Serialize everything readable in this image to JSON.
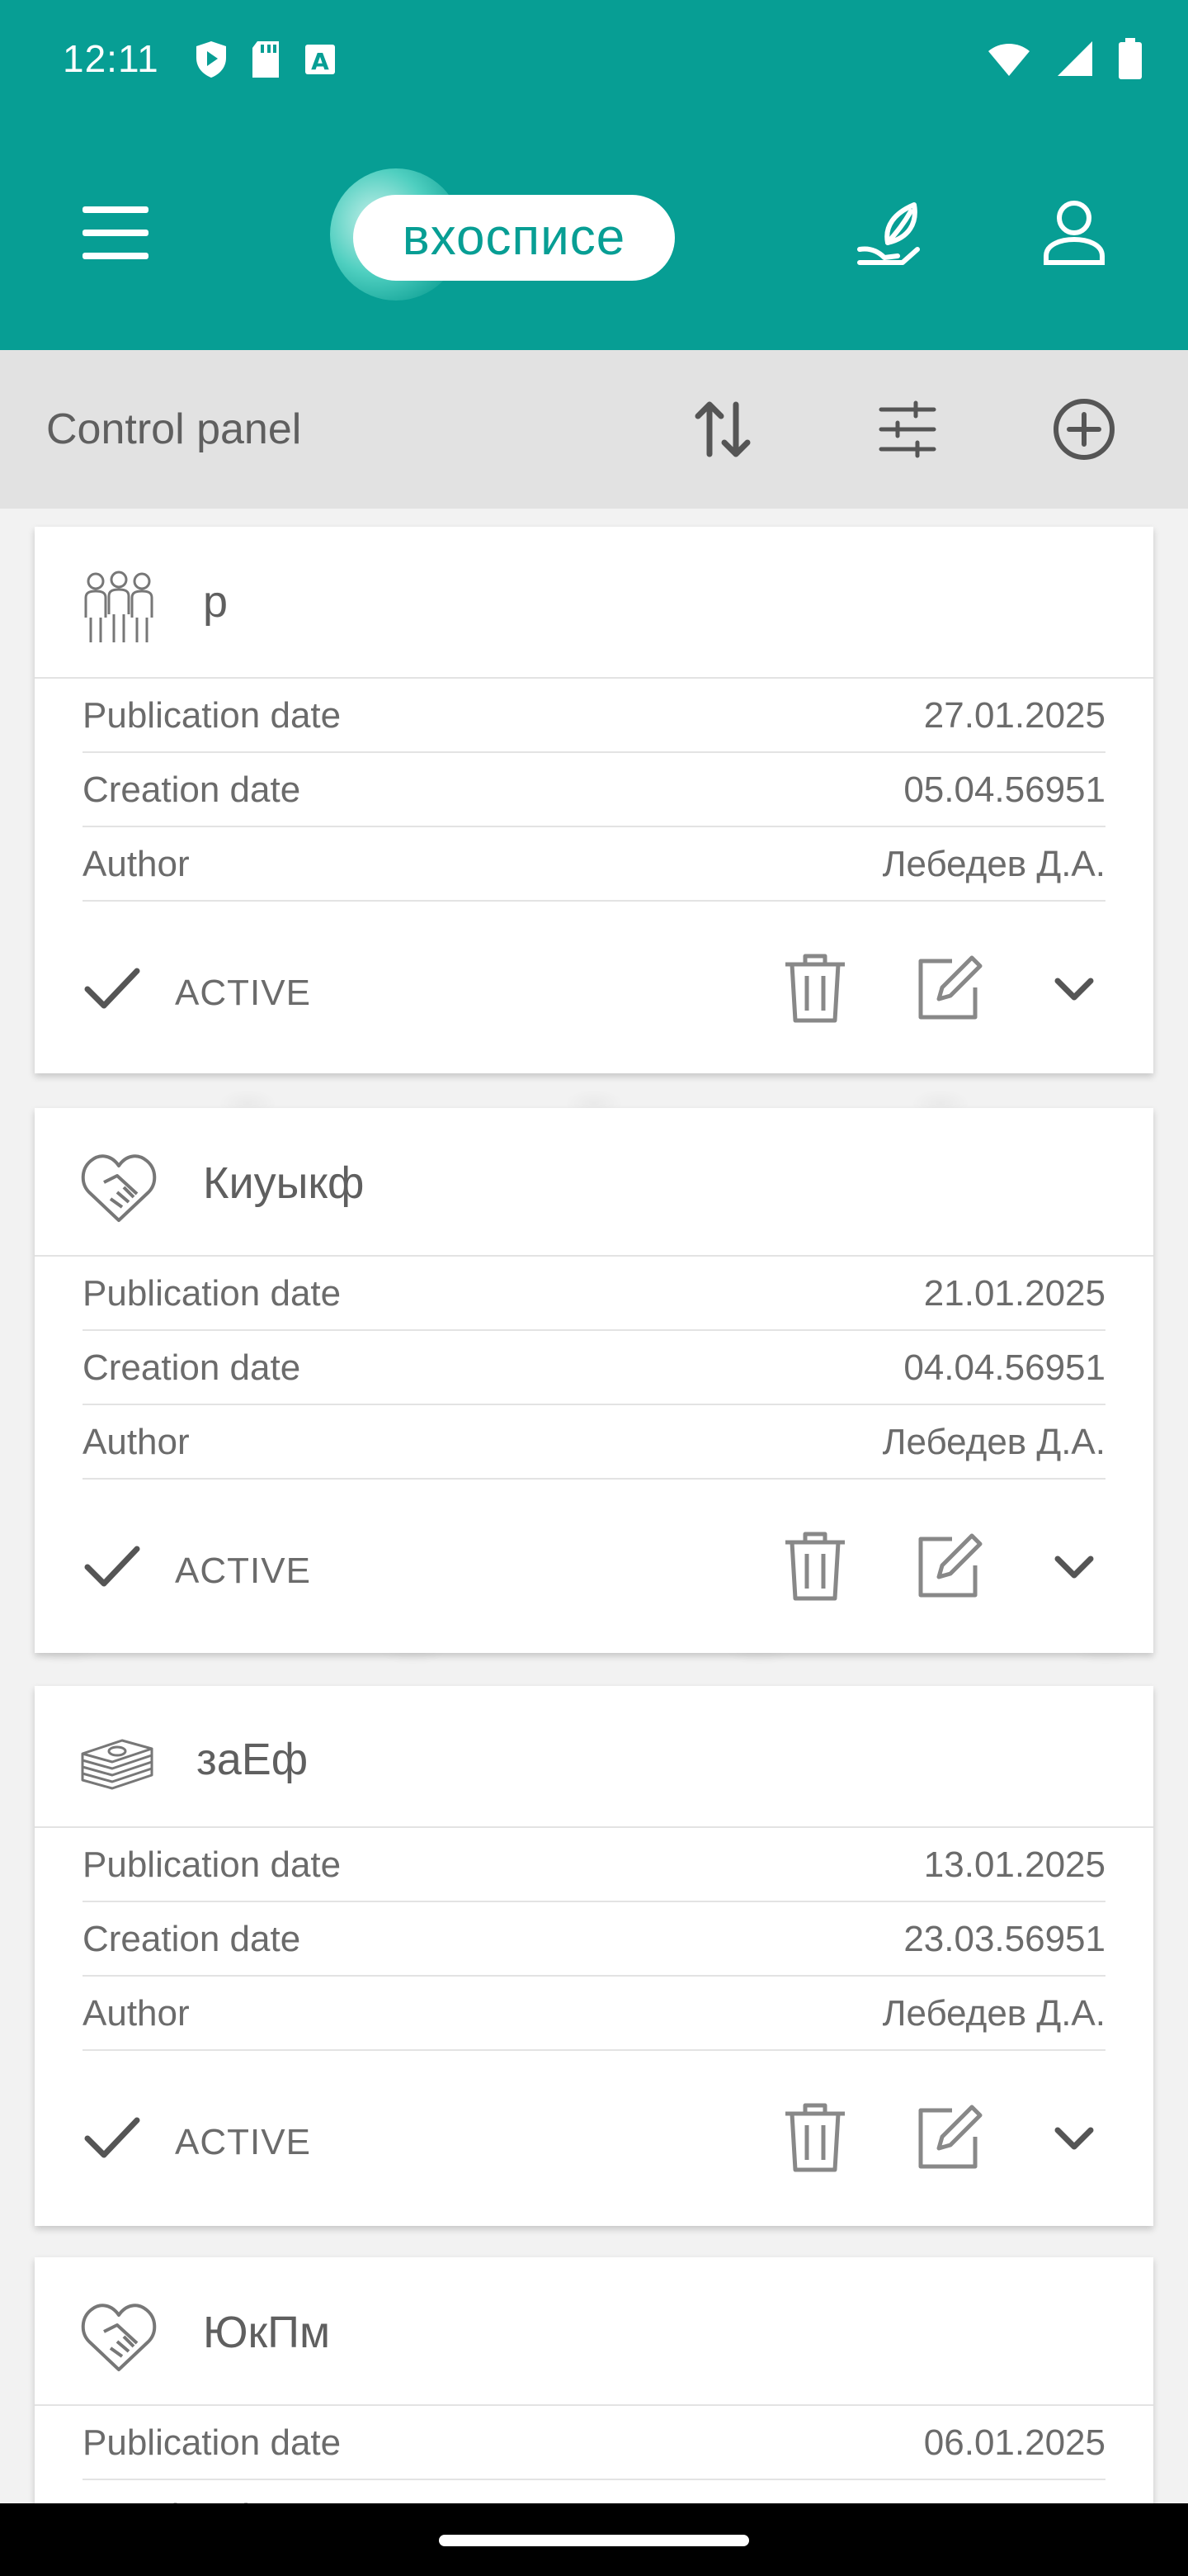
{
  "status_bar": {
    "time": "12:11",
    "left_icons": [
      "shield-play-icon",
      "sd-card-icon",
      "font-a-icon"
    ],
    "right_icons": [
      "wifi-icon",
      "signal-icon",
      "battery-icon"
    ]
  },
  "app_bar": {
    "logo_text": "вхосписе",
    "menu_icon": "hamburger-menu-icon",
    "leaf_icon": "leaf-hand-icon",
    "profile_icon": "profile-icon",
    "color": "#079e94"
  },
  "toolbar": {
    "title": "Control panel",
    "sort_icon": "sort-icon",
    "filter_icon": "filter-sliders-icon",
    "add_icon": "add-circle-icon"
  },
  "labels": {
    "publication_date": "Publication date",
    "creation_date": "Creation date",
    "author": "Author"
  },
  "cards": [
    {
      "icon": "family-icon",
      "title": "р",
      "publication_date": "27.01.2025",
      "creation_date": "05.04.56951",
      "author": "Лебедев Д.А.",
      "status": "ACTIVE"
    },
    {
      "icon": "handshake-heart-icon",
      "title": "Киуыкф",
      "publication_date": "21.01.2025",
      "creation_date": "04.04.56951",
      "author": "Лебедев Д.А.",
      "status": "ACTIVE"
    },
    {
      "icon": "money-stack-icon",
      "title": "заЕф",
      "publication_date": "13.01.2025",
      "creation_date": "23.03.56951",
      "author": "Лебедев Д.А.",
      "status": "ACTIVE"
    },
    {
      "icon": "handshake-heart-icon",
      "title": "ЮкПм",
      "publication_date": "06.01.2025",
      "creation_date": "",
      "author": "",
      "status": ""
    }
  ]
}
